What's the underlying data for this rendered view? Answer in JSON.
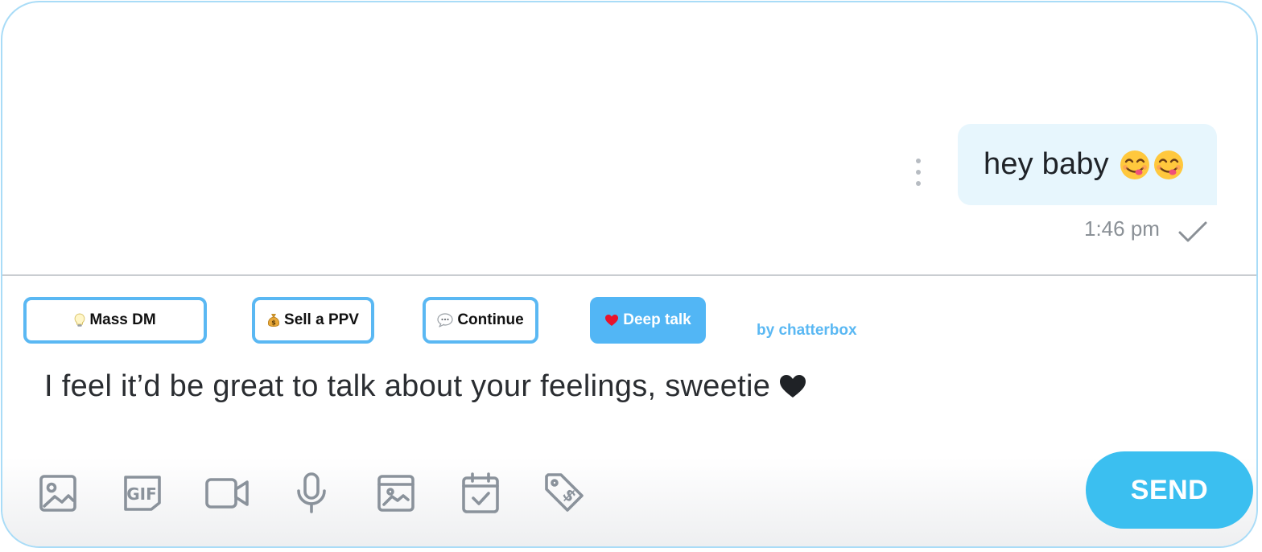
{
  "chat": {
    "message_text": "hey baby",
    "message_emoji": "face-savoring-food x2",
    "timestamp": "1:46 pm",
    "status_icon": "check-icon"
  },
  "suggestions": {
    "mass_dm": {
      "icon": "lightbulb-icon",
      "label": "Mass DM"
    },
    "sell_ppv": {
      "icon": "money-bag-icon",
      "label": "Sell a PPV"
    },
    "continue": {
      "icon": "speech-bubble-icon",
      "label": "Continue"
    },
    "deep_talk": {
      "icon": "heart-icon",
      "label": "Deep talk",
      "active": true
    },
    "byline": "by chatterbox"
  },
  "composer": {
    "text": "I feel it’d be great to talk about your feelings, sweetie",
    "trailing_icon": "black-heart-icon"
  },
  "toolbar": {
    "tools": [
      "image-icon",
      "gif-icon",
      "video-icon",
      "microphone-icon",
      "vault-icon",
      "schedule-icon",
      "price-tag-icon"
    ],
    "send_label": "SEND"
  },
  "colors": {
    "accent": "#3bbff0",
    "border": "#a9dcf7",
    "bubble_bg": "#e7f6fd",
    "chip_border": "#5ab8f3",
    "icon_gray": "#8a929b"
  }
}
